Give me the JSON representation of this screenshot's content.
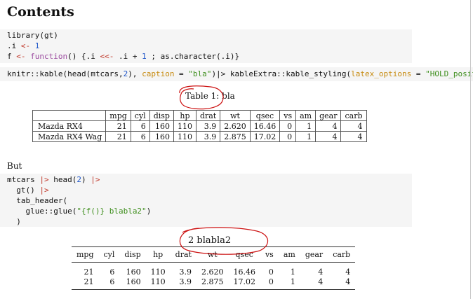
{
  "heading": "Contents",
  "code1": {
    "line1": "library(gt)",
    "line2_a": ".i ",
    "line2_op": "<-",
    "line2_num": " 1",
    "line3_a": "f ",
    "line3_op": "<-",
    "line3_kw": " function",
    "line3_b": "() {.i ",
    "line3_op2": "<<-",
    "line3_c": " .i + ",
    "line3_num": "1",
    "line3_d": " ; as.character(.i)}"
  },
  "code2": {
    "a": "knitr::kable(head(mtcars,",
    "num": "2",
    "b": "), ",
    "arg1": "caption",
    "c": " = ",
    "str1": "\"bla\"",
    "d": ")|> kableExtra::kable_styling(",
    "arg2": "latex_options",
    "e": " = ",
    "str2": "\"HOLD_positio"
  },
  "caption1": "Table 1: bla",
  "table1": {
    "headers": [
      "mpg",
      "cyl",
      "disp",
      "hp",
      "drat",
      "wt",
      "qsec",
      "vs",
      "am",
      "gear",
      "carb"
    ],
    "rows": [
      {
        "name": "Mazda RX4",
        "values": [
          "21",
          "6",
          "160",
          "110",
          "3.9",
          "2.620",
          "16.46",
          "0",
          "1",
          "4",
          "4"
        ]
      },
      {
        "name": "Mazda RX4 Wag",
        "values": [
          "21",
          "6",
          "160",
          "110",
          "3.9",
          "2.875",
          "17.02",
          "0",
          "1",
          "4",
          "4"
        ]
      }
    ]
  },
  "paragraph": "But",
  "code3": {
    "l1_a": "mtcars ",
    "l1_op": "|>",
    "l1_b": " head(",
    "l1_num": "2",
    "l1_c": ") ",
    "l1_op2": "|>",
    "l2_a": "  gt() ",
    "l2_op": "|>",
    "l3": "  tab_header(",
    "l4_a": "    glue::glue(",
    "l4_str": "\"{f()} blabla2\"",
    "l4_b": ")",
    "l5": "  )"
  },
  "caption2": "2 blabla2",
  "table2": {
    "headers": [
      "mpg",
      "cyl",
      "disp",
      "hp",
      "drat",
      "wt",
      "qsec",
      "vs",
      "am",
      "gear",
      "carb"
    ],
    "rows": [
      [
        "21",
        "6",
        "160",
        "110",
        "3.9",
        "2.620",
        "16.46",
        "0",
        "1",
        "4",
        "4"
      ],
      [
        "21",
        "6",
        "160",
        "110",
        "3.9",
        "2.875",
        "17.02",
        "0",
        "1",
        "4",
        "4"
      ]
    ]
  },
  "colors": {
    "code_bg": "#f5f5f5",
    "annotation": "#cc1111"
  }
}
